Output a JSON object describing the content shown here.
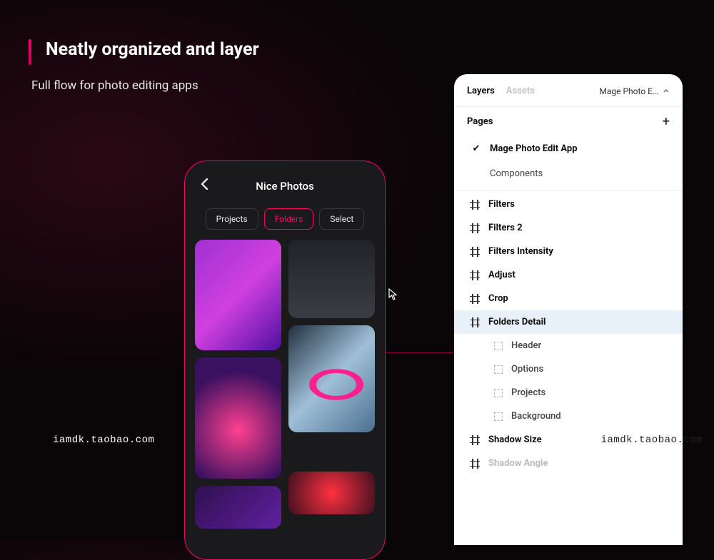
{
  "hero": {
    "headline": "Neatly organized and layer",
    "subhead": "Full flow for photo editing apps"
  },
  "watermark": "iamdk.taobao.com",
  "phone": {
    "title": "Nice Photos",
    "chips": {
      "projects": "Projects",
      "folders": "Folders",
      "select": "Select"
    }
  },
  "panel": {
    "tabs": {
      "layers": "Layers",
      "assets": "Assets"
    },
    "file": "Mage Photo E…",
    "pages_label": "Pages",
    "pages": [
      {
        "name": "Mage Photo Edit App",
        "selected": true
      },
      {
        "name": "Components",
        "selected": false
      }
    ],
    "layers": [
      {
        "name": "Filters",
        "type": "frame"
      },
      {
        "name": "Filters 2",
        "type": "frame"
      },
      {
        "name": "Filters Intensity",
        "type": "frame"
      },
      {
        "name": "Adjust",
        "type": "frame"
      },
      {
        "name": "Crop",
        "type": "frame"
      },
      {
        "name": "Folders Detail",
        "type": "frame",
        "highlight": true
      },
      {
        "name": "Header",
        "type": "child"
      },
      {
        "name": "Options",
        "type": "child"
      },
      {
        "name": "Projects",
        "type": "child"
      },
      {
        "name": "Background",
        "type": "child"
      },
      {
        "name": "Shadow Size",
        "type": "frame"
      },
      {
        "name": "Shadow Angle",
        "type": "frame",
        "dim": true
      }
    ]
  }
}
